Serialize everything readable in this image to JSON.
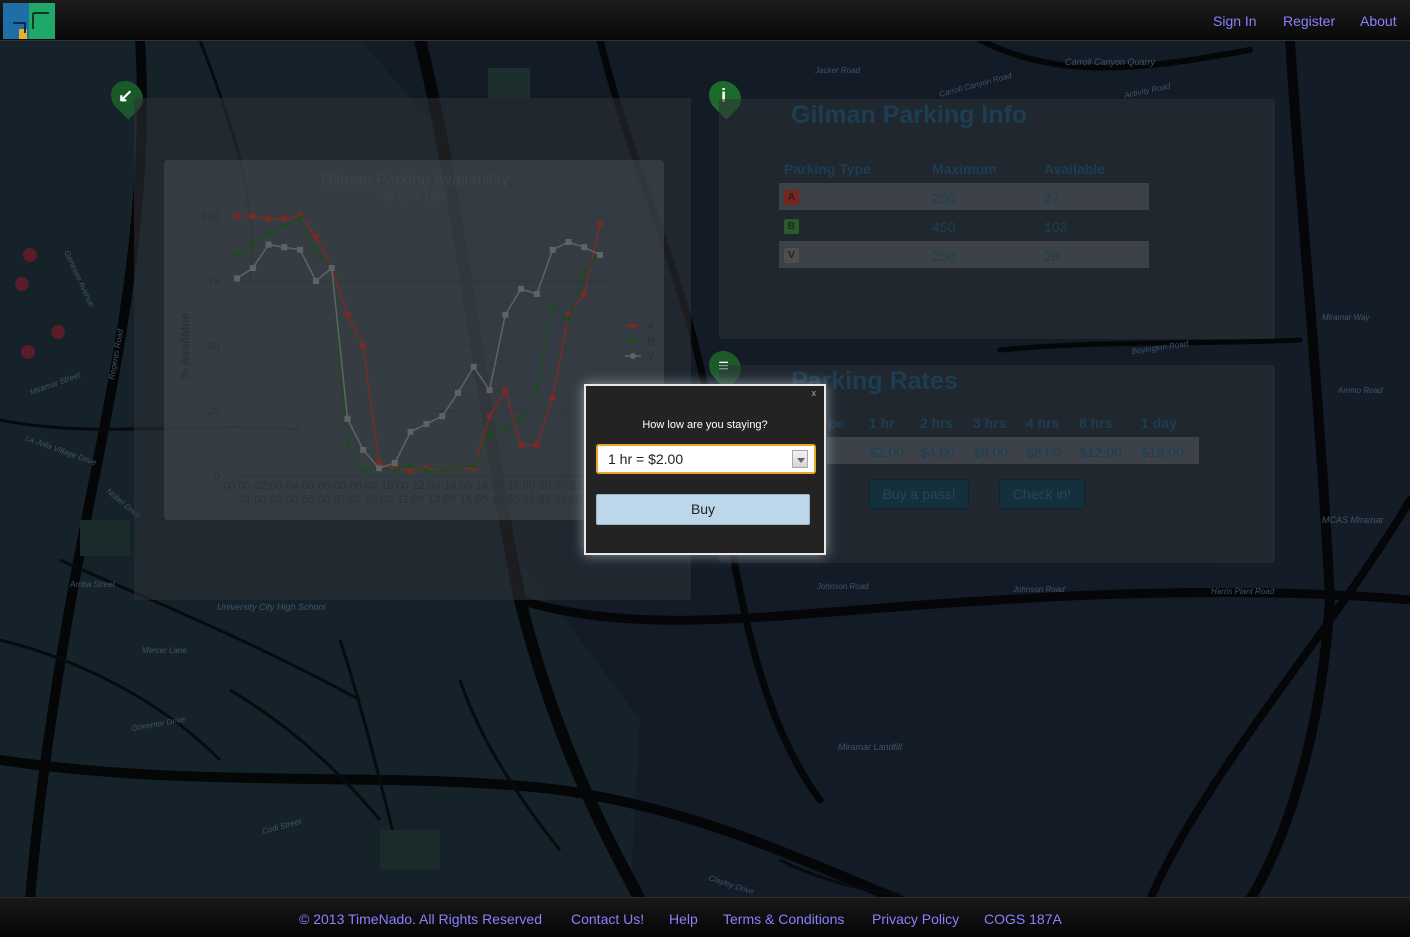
{
  "nav": {
    "sign_in": "Sign In",
    "register": "Register",
    "about": "About"
  },
  "map_labels": [
    "Jacker Road",
    "Carroll Canyon Quarry",
    "Carroll Canyon Road",
    "Activity Road",
    "Miramar Way",
    "Boyington Road",
    "Ammo Road",
    "MCAS Miramar",
    "Johnson Road",
    "Johnson Road",
    "Harris Plant Road",
    "Miramar Landfill",
    "University City High School",
    "Mercer Lane",
    "Governor Drive",
    "Genesee Avenue",
    "Regents Road",
    "Miramar Street",
    "La Jolla Village Drive",
    "Arriba Street",
    "Nobel Drive",
    "Codi Street",
    "Clayley Drive"
  ],
  "info": {
    "title": "Gilman Parking Info",
    "headers": [
      "Parking Type",
      "Maximum",
      "Available"
    ],
    "rows": [
      {
        "type": "A",
        "maximum": "200",
        "available": "87"
      },
      {
        "type": "B",
        "maximum": "450",
        "available": "103"
      },
      {
        "type": "V",
        "maximum": "250",
        "available": "28"
      }
    ]
  },
  "rates": {
    "title": "Parking Rates",
    "headers": [
      "pe",
      "1 hr",
      "2 hrs",
      "3 hrs",
      "4 hrs",
      "8 hrs",
      "1 day"
    ],
    "values": [
      "$2.00",
      "$4.00",
      "$6.00",
      "$8.00",
      "$12.00",
      "$16.00"
    ],
    "buy_pass": "Buy a pass!",
    "check_in": "Check in!"
  },
  "dialog": {
    "close": "x",
    "question": "How low are you staying?",
    "selected_option": "1 hr = $2.00",
    "buy": "Buy"
  },
  "footer": {
    "copyright": "© 2013 TimeNado. All Rights Reserved",
    "contact": "Contact Us!",
    "help": "Help",
    "terms": "Terms & Conditions",
    "privacy": "Privacy Policy",
    "cogs": "COGS 187A"
  },
  "colors": {
    "link": "#8a80ff",
    "series_a": "#c0392b",
    "series_b": "#2e7d32",
    "series_v": "#9e9e9e",
    "dialog_focus": "#e9a62a",
    "buy_button": "#bcd7ea"
  },
  "chart_data": {
    "type": "line",
    "title": "Gilman Parking Availability",
    "subtitle": "by Spot Type",
    "xlabel": "",
    "ylabel": "% Available",
    "ylim": [
      0,
      100
    ],
    "yticks": [
      0,
      25,
      50,
      75,
      100
    ],
    "grid": true,
    "legend": "right",
    "categories": [
      "00:00",
      "01:00",
      "02:00",
      "03:00",
      "04:00",
      "05:00",
      "06:00",
      "07:00",
      "08:00",
      "09:00",
      "10:00",
      "11:00",
      "12:00",
      "13:00",
      "14:00",
      "15:00",
      "16:00",
      "17:00",
      "18:00",
      "19:00",
      "20:00",
      "21:00",
      "22:00",
      "23:00"
    ],
    "series": [
      {
        "name": "A",
        "values": [
          100,
          100,
          99,
          99,
          100,
          92,
          80,
          62,
          50,
          5,
          3,
          2,
          3,
          2,
          3,
          3,
          23,
          33,
          12,
          12,
          30,
          62,
          70,
          97
        ]
      },
      {
        "name": "B",
        "values": [
          85,
          89,
          93,
          96,
          99,
          87,
          80,
          12,
          2,
          3,
          2,
          4,
          2,
          2,
          3,
          4,
          16,
          18,
          22,
          34,
          65,
          60,
          78,
          86
        ]
      },
      {
        "name": "V",
        "values": [
          76,
          80,
          89,
          88,
          87,
          75,
          80,
          22,
          10,
          3,
          5,
          17,
          20,
          23,
          32,
          42,
          33,
          62,
          72,
          70,
          87,
          90,
          88,
          85
        ]
      }
    ]
  }
}
